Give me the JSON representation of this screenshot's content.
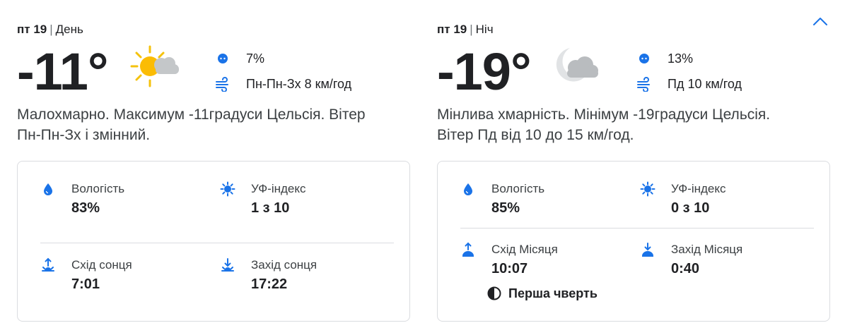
{
  "day": {
    "header_date": "пт 19",
    "header_sep": "|",
    "header_period": "День",
    "temperature": "-11°",
    "icon": "sun-cloud-icon",
    "precip": "7%",
    "wind": "Пн-Пн-Зх 8 км/год",
    "description": "Малохмарно. Максимум -11градуси Цельсія. Вітер Пн-Пн-Зх і змінний.",
    "humidity_label": "Вологість",
    "humidity_value": "83%",
    "uv_label": "УФ-індекс",
    "uv_value": "1 з 10",
    "rise_label": "Схід сонця",
    "rise_value": "7:01",
    "set_label": "Захід сонця",
    "set_value": "17:22"
  },
  "night": {
    "header_date": "пт 19",
    "header_sep": "|",
    "header_period": "Ніч",
    "temperature": "-19°",
    "icon": "moon-cloud-icon",
    "precip": "13%",
    "wind": "Пд 10 км/год",
    "description": "Мінлива хмарність. Мінімум -19градуси Цельсія. Вітер Пд від 10 до 15 км/год.",
    "humidity_label": "Вологість",
    "humidity_value": "85%",
    "uv_label": "УФ-індекс",
    "uv_value": "0 з 10",
    "rise_label": "Схід Місяця",
    "rise_value": "10:07",
    "set_label": "Захід Місяця",
    "set_value": "0:40",
    "moon_phase": "Перша чверть"
  },
  "colors": {
    "accent": "#1a73e8",
    "text": "#202124",
    "border": "#dadce0"
  }
}
